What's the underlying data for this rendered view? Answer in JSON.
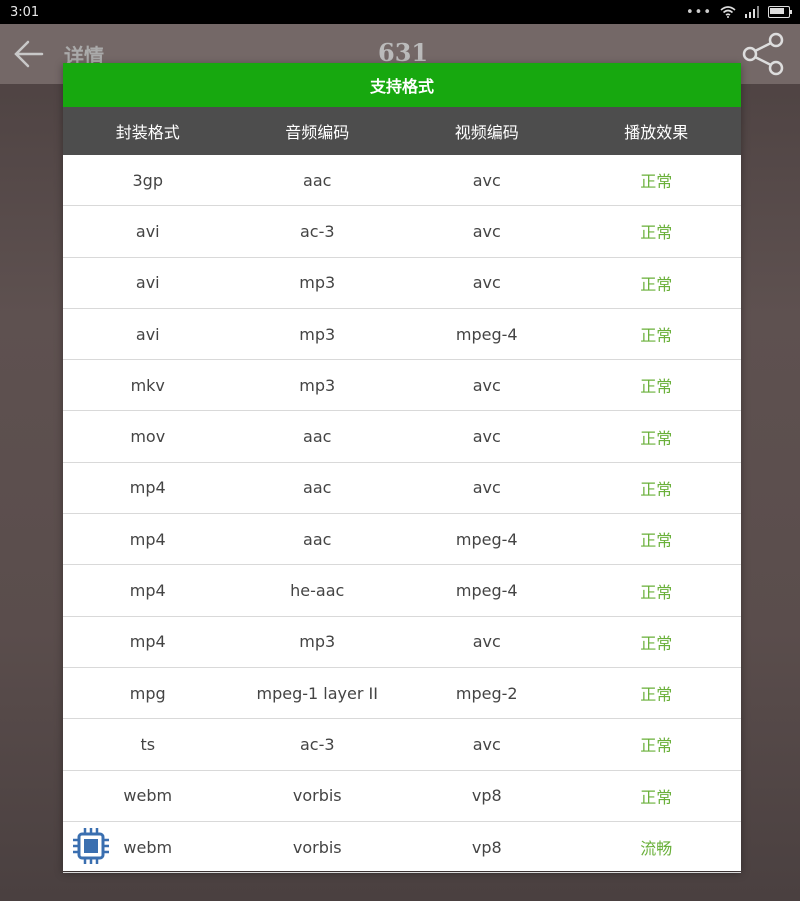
{
  "status_bar": {
    "time": "3:01"
  },
  "toolbar": {
    "title": "详情",
    "count": "631"
  },
  "dialog": {
    "title": "支持格式",
    "columns": [
      "封装格式",
      "音频编码",
      "视频编码",
      "播放效果"
    ],
    "rows": [
      [
        "3gp",
        "aac",
        "avc",
        "正常"
      ],
      [
        "avi",
        "ac-3",
        "avc",
        "正常"
      ],
      [
        "avi",
        "mp3",
        "avc",
        "正常"
      ],
      [
        "avi",
        "mp3",
        "mpeg-4",
        "正常"
      ],
      [
        "mkv",
        "mp3",
        "avc",
        "正常"
      ],
      [
        "mov",
        "aac",
        "avc",
        "正常"
      ],
      [
        "mp4",
        "aac",
        "avc",
        "正常"
      ],
      [
        "mp4",
        "aac",
        "mpeg-4",
        "正常"
      ],
      [
        "mp4",
        "he-aac",
        "mpeg-4",
        "正常"
      ],
      [
        "mp4",
        "mp3",
        "avc",
        "正常"
      ],
      [
        "mpg",
        "mpeg-1 layer II",
        "mpeg-2",
        "正常"
      ],
      [
        "ts",
        "ac-3",
        "avc",
        "正常"
      ],
      [
        "webm",
        "vorbis",
        "vp8",
        "正常"
      ],
      [
        "webm",
        "vorbis",
        "vp8",
        "流畅"
      ]
    ]
  },
  "colors": {
    "accent": "#17a80f",
    "effect_text": "#6ab03a",
    "header_bg": "#4d4d4d"
  },
  "icons": [
    "back-arrow-icon",
    "share-icon",
    "wifi-icon",
    "signal-icon",
    "battery-icon",
    "cpu-chip-icon"
  ]
}
